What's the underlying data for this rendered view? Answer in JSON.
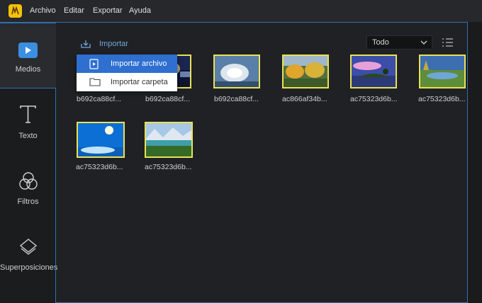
{
  "menubar": {
    "items": [
      "Archivo",
      "Editar",
      "Exportar",
      "Ayuda"
    ]
  },
  "sidebar": {
    "items": [
      {
        "label": "Medios",
        "icon": "media-play-icon",
        "active": true
      },
      {
        "label": "Texto",
        "icon": "text-t-icon",
        "active": false
      },
      {
        "label": "Filtros",
        "icon": "filters-circles-icon",
        "active": false
      },
      {
        "label": "Superposiciones",
        "icon": "overlay-layers-icon",
        "active": false
      }
    ]
  },
  "toolbar": {
    "import_label": "Importar",
    "filter_value": "Todo"
  },
  "import_menu": {
    "items": [
      {
        "label": "Importar archivo",
        "icon": "file-play-icon",
        "highlighted": true
      },
      {
        "label": "Importar carpeta",
        "icon": "folder-icon",
        "highlighted": false
      }
    ]
  },
  "media": {
    "items": [
      {
        "name": "b692ca88cf..."
      },
      {
        "name": "b692ca88cf..."
      },
      {
        "name": "b692ca88cf..."
      },
      {
        "name": "ac866af34b..."
      },
      {
        "name": "ac75323d6b..."
      },
      {
        "name": "ac75323d6b..."
      },
      {
        "name": "ac75323d6b..."
      },
      {
        "name": "ac75323d6b..."
      }
    ]
  },
  "colors": {
    "accent": "#2f6fb0",
    "thumb_border": "#e8e15a",
    "menu_highlight": "#2e6fd0",
    "logo": "#f4c20d"
  }
}
